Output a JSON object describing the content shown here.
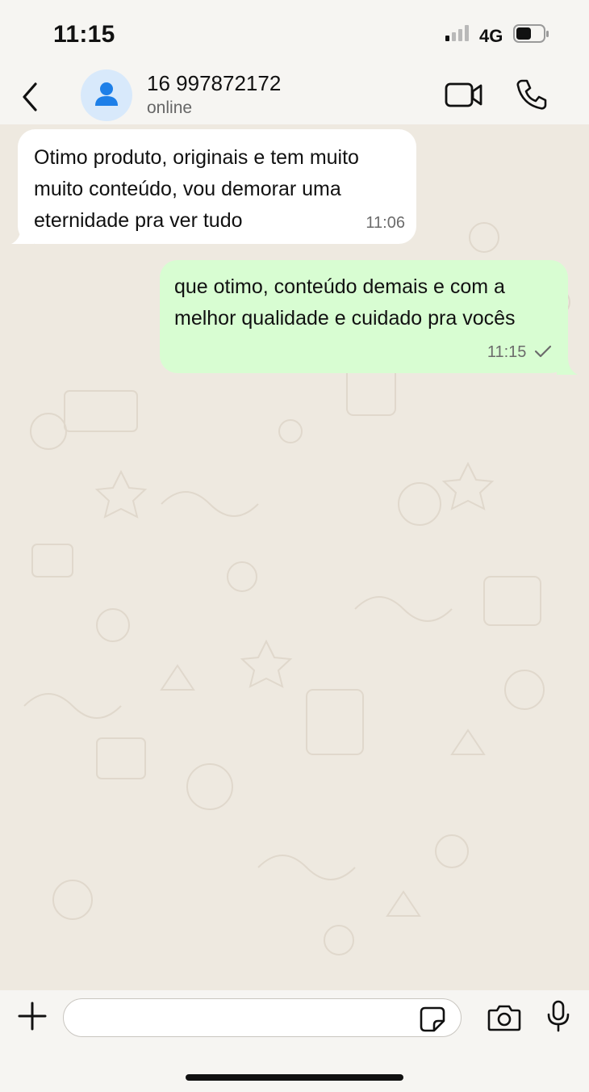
{
  "status_bar": {
    "time": "11:15",
    "network": "4G"
  },
  "header": {
    "contact_name": "16 997872172",
    "contact_status": "online",
    "icons": [
      "back-icon",
      "avatar-person-icon",
      "video-call-icon",
      "phone-call-icon"
    ]
  },
  "messages": [
    {
      "direction": "incoming",
      "text": "Otimo produto, originais e tem muito muito conteúdo, vou demorar uma eternidade pra ver tudo",
      "time": "11:06"
    },
    {
      "direction": "outgoing",
      "text": "que otimo, conteúdo demais e com a melhor qualidade e cuidado pra vocês",
      "time": "11:15",
      "status_icon": "sent-check-icon"
    }
  ],
  "composer": {
    "input_value": "",
    "icons": [
      "plus-icon",
      "sticker-icon",
      "camera-icon",
      "microphone-icon"
    ]
  },
  "colors": {
    "chat_background": "#eee9e0",
    "incoming_bubble": "#ffffff",
    "outgoing_bubble": "#d8fdd2",
    "avatar_background": "#d8e9fb",
    "avatar_icon": "#1d7fe8"
  }
}
